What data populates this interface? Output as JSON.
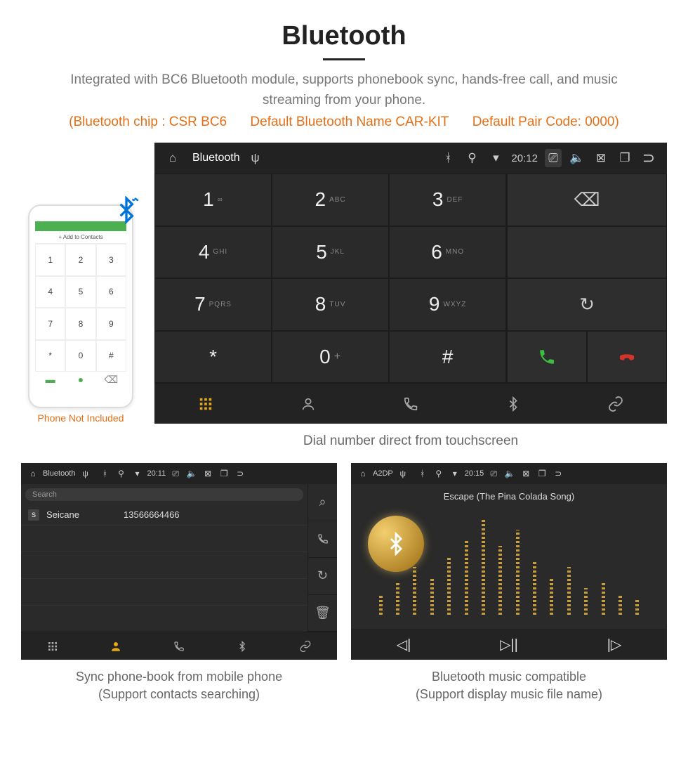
{
  "title": "Bluetooth",
  "subtitle": "Integrated with BC6 Bluetooth module, supports phonebook sync, hands-free call, and music streaming from your phone.",
  "bt_info": {
    "chip": "(Bluetooth chip : CSR BC6",
    "name": "Default Bluetooth Name CAR-KIT",
    "code": "Default Pair Code: 0000)"
  },
  "phone_mock": {
    "add": "+  Add to Contacts",
    "keys": [
      "1",
      "2",
      "3",
      "4",
      "5",
      "6",
      "7",
      "8",
      "9",
      "*",
      "0",
      "#"
    ],
    "caption": "Phone Not Included"
  },
  "main": {
    "title": "Bluetooth",
    "time": "20:12",
    "keys": [
      {
        "n": "1",
        "l": "∞"
      },
      {
        "n": "2",
        "l": "ABC"
      },
      {
        "n": "3",
        "l": "DEF"
      },
      {
        "n": "4",
        "l": "GHI"
      },
      {
        "n": "5",
        "l": "JKL"
      },
      {
        "n": "6",
        "l": "MNO"
      },
      {
        "n": "7",
        "l": "PQRS"
      },
      {
        "n": "8",
        "l": "TUV"
      },
      {
        "n": "9",
        "l": "WXYZ"
      },
      {
        "n": "*",
        "l": ""
      },
      {
        "n": "0",
        "l": "+"
      },
      {
        "n": "#",
        "l": ""
      }
    ],
    "caption": "Dial number direct from touchscreen"
  },
  "contacts": {
    "title": "Bluetooth",
    "time": "20:11",
    "search": "Search",
    "item": {
      "badge": "S",
      "name": "Seicane",
      "num": "13566664466"
    },
    "caption1": "Sync phone-book from mobile phone",
    "caption2": "(Support contacts searching)"
  },
  "music": {
    "title": "A2DP",
    "time": "20:15",
    "song": "Escape (The Pina Colada Song)",
    "caption1": "Bluetooth music compatible",
    "caption2": "(Support display music file name)"
  }
}
